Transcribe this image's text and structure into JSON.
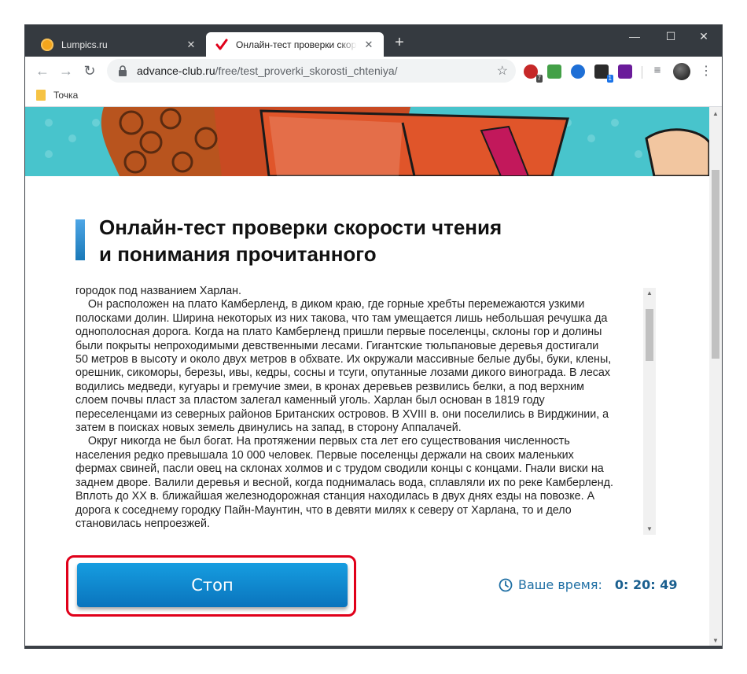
{
  "browser": {
    "tabs": [
      {
        "title": "Lumpics.ru",
        "favicon": "orange-circle-favicon"
      },
      {
        "title": "Онлайн-тест проверки скорос",
        "favicon": "red-check-favicon"
      }
    ],
    "close_glyph": "✕",
    "new_tab_glyph": "+",
    "window_controls": {
      "minimize": "—",
      "maximize": "☐",
      "close": "✕"
    },
    "address": {
      "host": "advance-club.ru",
      "path": "/free/test_proverki_skorosti_chteniya/"
    },
    "nav": {
      "back": "←",
      "forward": "→",
      "reload": "↻"
    },
    "star_glyph": "☆",
    "menu_glyph": "⋮",
    "extensions": [
      {
        "icon": "opera-adblock-icon",
        "badge": "7"
      },
      {
        "icon": "music-note-icon",
        "badge": ""
      },
      {
        "icon": "globe-vpn-icon",
        "badge": ""
      },
      {
        "icon": "cube-extension-icon",
        "badge": "1"
      },
      {
        "icon": "purple-extension-icon",
        "badge": ""
      }
    ],
    "bookmarks": [
      {
        "label": "Точка"
      }
    ]
  },
  "page": {
    "title_line1": "Онлайн-тест проверки скорости чтения",
    "title_line2": "и понимания прочитанного",
    "text_lines": [
      "городок под названием Харлан.",
      "    Он расположен на плато Камберленд, в диком краю, где горные хребты перемежаются узкими",
      "полосками долин. Ширина некоторых из них такова, что там умещается лишь небольшая речушка да",
      "однополосная дорога. Когда на плато Камберленд пришли первые поселенцы, склоны гор и долины",
      "были покрыты непроходимыми девственными лесами. Гигантские тюльпановые деревья достигали",
      "50 метров в высоту и около двух метров в обхвате. Их окружали массивные белые дубы, буки, клены,",
      "орешник, сикоморы, березы, ивы, кедры, сосны и тсуги, опутанные лозами дикого винограда. В лесах",
      "водились медведи, кугуары и гремучие змеи, в кронах деревьев резвились белки, а под верхним",
      "слоем почвы пласт за пластом залегал каменный уголь. Харлан был основан в 1819 году",
      "переселенцами из северных районов Британских островов. В XVIII в. они поселились в Вирджинии, а",
      "затем в поисках новых земель двинулись на запад, в сторону Аппалачей.",
      "    Округ никогда не был богат. На протяжении первых ста лет его существования численность",
      "населения редко превышала 10 000 человек. Первые поселенцы держали на своих маленьких",
      "фермах свиней, пасли овец на склонах холмов и с трудом сводили концы с концами. Гнали виски на",
      "заднем дворе. Валили деревья и весной, когда поднималась вода, сплавляли их по реке Камберленд.",
      "Вплоть до XX в. ближайшая железнодорожная станция находилась в двух днях езды на повозке. А",
      "дорога к соседнему городку Пайн-Маунтин, что в девяти милях к северу от Харлана, то и дело",
      "становилась непроезжей."
    ],
    "stop_button": "Стоп",
    "timer_label": "Ваше время:",
    "timer_value": "0: 20: 49"
  },
  "colors": {
    "tabbar": "#353a40",
    "stop_button": "#0a74bd",
    "highlight": "#e0001a",
    "timer_text": "#1f6fa4"
  }
}
